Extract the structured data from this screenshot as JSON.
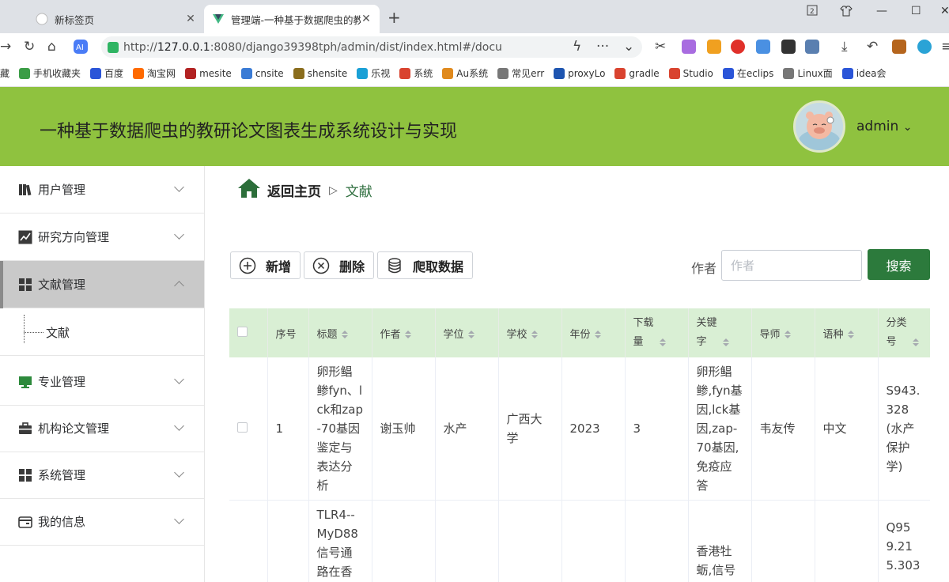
{
  "browser": {
    "tabs": [
      {
        "label": "新标签页"
      },
      {
        "label": "管理端-一种基于数据爬虫的教研"
      }
    ],
    "url_host": "127.0.0.1",
    "url_prefix": "http://",
    "url_rest": ":8080/django39398tph/admin/dist/index.html#/docu",
    "bookmarks": [
      {
        "label": "藏",
        "color": "#ffffff"
      },
      {
        "label": "手机收藏夹",
        "color": "#3b9d46"
      },
      {
        "label": "百度",
        "color": "#2b55d8"
      },
      {
        "label": "淘宝网",
        "color": "#ff6a00"
      },
      {
        "label": "mesite",
        "color": "#b22222"
      },
      {
        "label": "cnsite",
        "color": "#3a7bd5"
      },
      {
        "label": "shensite",
        "color": "#8a6d1d"
      },
      {
        "label": "乐视",
        "color": "#1aa0d6"
      },
      {
        "label": "系统",
        "color": "#d9432f"
      },
      {
        "label": "Au系统",
        "color": "#e08a1e"
      },
      {
        "label": "常见err",
        "color": "#777777"
      },
      {
        "label": "proxyLo",
        "color": "#1e55b0"
      },
      {
        "label": "gradle",
        "color": "#d9432f"
      },
      {
        "label": "Studio",
        "color": "#d9432f"
      },
      {
        "label": "在eclips",
        "color": "#2b55d8"
      },
      {
        "label": "Linux面",
        "color": "#777777"
      },
      {
        "label": "idea会",
        "color": "#2b55d8"
      }
    ]
  },
  "header": {
    "title": "一种基于数据爬虫的教研论文图表生成系统设计与实现",
    "user": "admin",
    "user_caret": "⌄"
  },
  "sidebar": {
    "items": [
      {
        "label": "用户管理"
      },
      {
        "label": "研究方向管理"
      },
      {
        "label": "文献管理"
      },
      {
        "label": "专业管理"
      },
      {
        "label": "机构论文管理"
      },
      {
        "label": "系统管理"
      },
      {
        "label": "我的信息"
      }
    ],
    "sub_item": "文献"
  },
  "breadcrumb": {
    "home": "返回主页",
    "separator": "▷",
    "current": "文献"
  },
  "toolbar": {
    "add": "新增",
    "delete": "删除",
    "crawl": "爬取数据",
    "search_label": "作者",
    "search_placeholder": "作者",
    "search_button": "搜索"
  },
  "table": {
    "columns": [
      "序号",
      "标题",
      "作者",
      "学位",
      "学校",
      "年份",
      "下载量",
      "关键字",
      "导师",
      "语种",
      "分类号"
    ],
    "rows": [
      {
        "index": "1",
        "title": "卵形鲳鲹fyn、lck和zap-70基因鉴定与表达分析",
        "author": "谢玉帅",
        "degree": "水产",
        "school": "广西大学",
        "year": "2023",
        "downloads": "3",
        "keywords": "卵形鲳鲹,fyn基因,lck基因,zap-70基因,免疫应答",
        "advisor": "韦友传",
        "language": "中文",
        "classno": "S943.328(水产保护学)"
      },
      {
        "index": "",
        "title": "TLR4--MyD88信号通路在香",
        "author": "",
        "degree": "",
        "school": "",
        "year": "",
        "downloads": "",
        "keywords": "香港牡蛎,信号",
        "advisor": "",
        "language": "",
        "classno": "Q959.215.303"
      }
    ]
  }
}
